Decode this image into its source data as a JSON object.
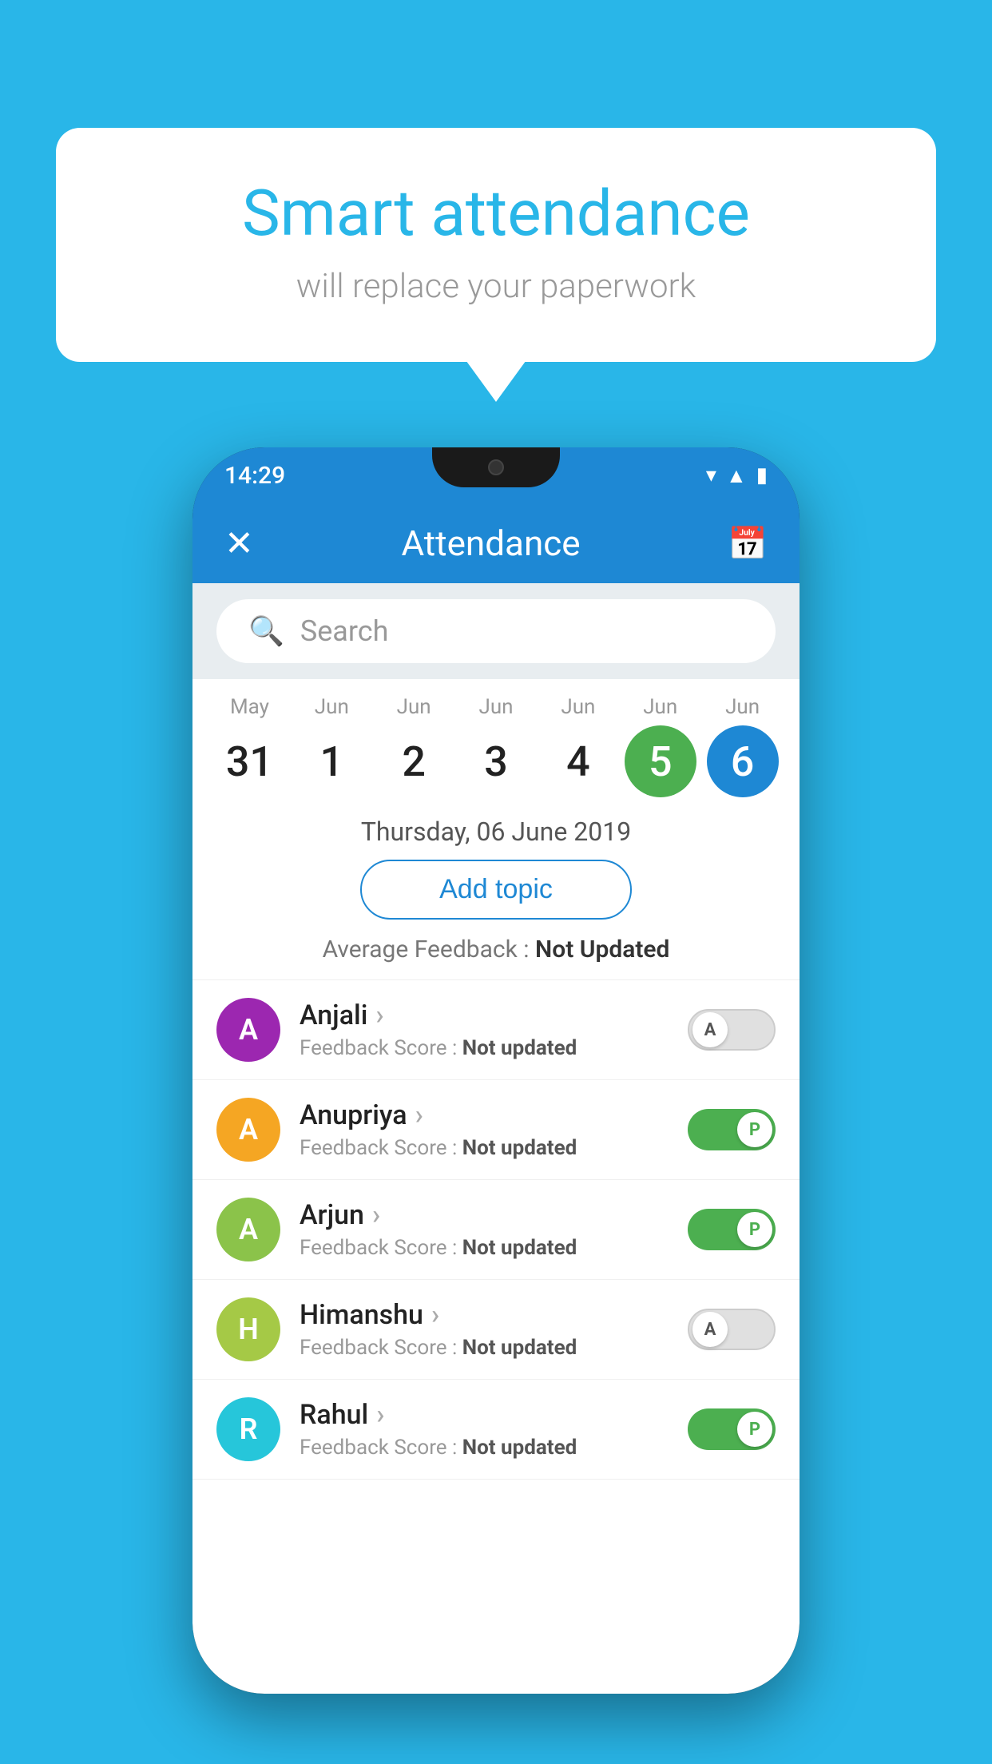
{
  "background_color": "#29b6e8",
  "bubble": {
    "title": "Smart attendance",
    "subtitle": "will replace your paperwork"
  },
  "phone": {
    "status_bar": {
      "time": "14:29",
      "icons": [
        "wifi",
        "signal",
        "battery"
      ]
    },
    "header": {
      "title": "Attendance",
      "close_icon": "×",
      "calendar_icon": "📅"
    },
    "search": {
      "placeholder": "Search"
    },
    "dates": [
      {
        "month": "May",
        "day": "31",
        "state": "normal"
      },
      {
        "month": "Jun",
        "day": "1",
        "state": "normal"
      },
      {
        "month": "Jun",
        "day": "2",
        "state": "normal"
      },
      {
        "month": "Jun",
        "day": "3",
        "state": "normal"
      },
      {
        "month": "Jun",
        "day": "4",
        "state": "normal"
      },
      {
        "month": "Jun",
        "day": "5",
        "state": "today"
      },
      {
        "month": "Jun",
        "day": "6",
        "state": "selected"
      }
    ],
    "selected_date": "Thursday, 06 June 2019",
    "add_topic_label": "Add topic",
    "avg_feedback_label": "Average Feedback :",
    "avg_feedback_value": "Not Updated",
    "students": [
      {
        "name": "Anjali",
        "avatar_letter": "A",
        "avatar_color": "#9c27b0",
        "feedback_label": "Feedback Score :",
        "feedback_value": "Not updated",
        "toggle_state": "off",
        "toggle_letter": "A"
      },
      {
        "name": "Anupriya",
        "avatar_letter": "A",
        "avatar_color": "#f5a623",
        "feedback_label": "Feedback Score :",
        "feedback_value": "Not updated",
        "toggle_state": "on",
        "toggle_letter": "P"
      },
      {
        "name": "Arjun",
        "avatar_letter": "A",
        "avatar_color": "#8bc34a",
        "feedback_label": "Feedback Score :",
        "feedback_value": "Not updated",
        "toggle_state": "on",
        "toggle_letter": "P"
      },
      {
        "name": "Himanshu",
        "avatar_letter": "H",
        "avatar_color": "#a5c946",
        "feedback_label": "Feedback Score :",
        "feedback_value": "Not updated",
        "toggle_state": "off",
        "toggle_letter": "A"
      },
      {
        "name": "Rahul",
        "avatar_letter": "R",
        "avatar_color": "#26c6da",
        "feedback_label": "Feedback Score :",
        "feedback_value": "Not updated",
        "toggle_state": "on",
        "toggle_letter": "P"
      }
    ]
  }
}
